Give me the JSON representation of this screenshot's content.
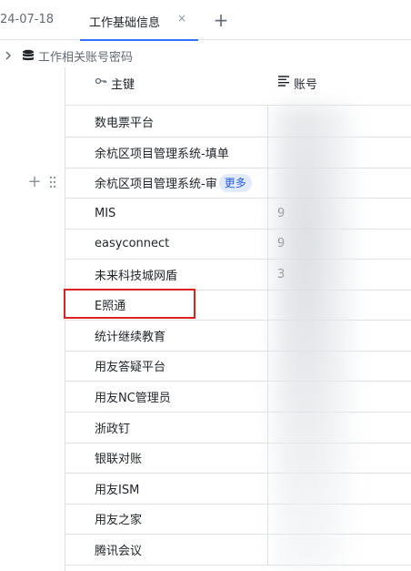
{
  "tabs": {
    "previous_label": "24-07-18",
    "active_label": "工作基础信息",
    "close_glyph": "×",
    "add_glyph": "+"
  },
  "breadcrumb": {
    "title": "工作相关账号密码"
  },
  "grid": {
    "columns": {
      "key_label": "主键",
      "account_label": "账号"
    },
    "rows": [
      {
        "key": "数电票平台",
        "account": ""
      },
      {
        "key": "余杭区项目管理系统-填单",
        "account": ""
      },
      {
        "key": "余杭区项目管理系统-审",
        "account": "",
        "tag": "更多"
      },
      {
        "key": "MIS",
        "account": "9"
      },
      {
        "key": "easyconnect",
        "account": "9"
      },
      {
        "key": "未来科技城网盾",
        "account": "3"
      },
      {
        "key": "E照通",
        "account": ""
      },
      {
        "key": "统计继续教育",
        "account": ""
      },
      {
        "key": "用友答疑平台",
        "account": ""
      },
      {
        "key": "用友NC管理员",
        "account": ""
      },
      {
        "key": "浙政钉",
        "account": ""
      },
      {
        "key": "银联对账",
        "account": ""
      },
      {
        "key": "用友ISM",
        "account": ""
      },
      {
        "key": "用友之家",
        "account": ""
      },
      {
        "key": "腾讯会议",
        "account": ""
      }
    ]
  },
  "row_tools": {
    "add_glyph": "+"
  },
  "colors": {
    "accent": "#3370ff",
    "annotation": "#e0201e",
    "tag_bg": "#e1eaff",
    "tag_text": "#245bdb"
  },
  "icons": [
    "chevron-right-icon",
    "database-icon",
    "key-icon",
    "text-lines-icon",
    "drag-handle-icon",
    "plus-icon",
    "close-icon"
  ]
}
